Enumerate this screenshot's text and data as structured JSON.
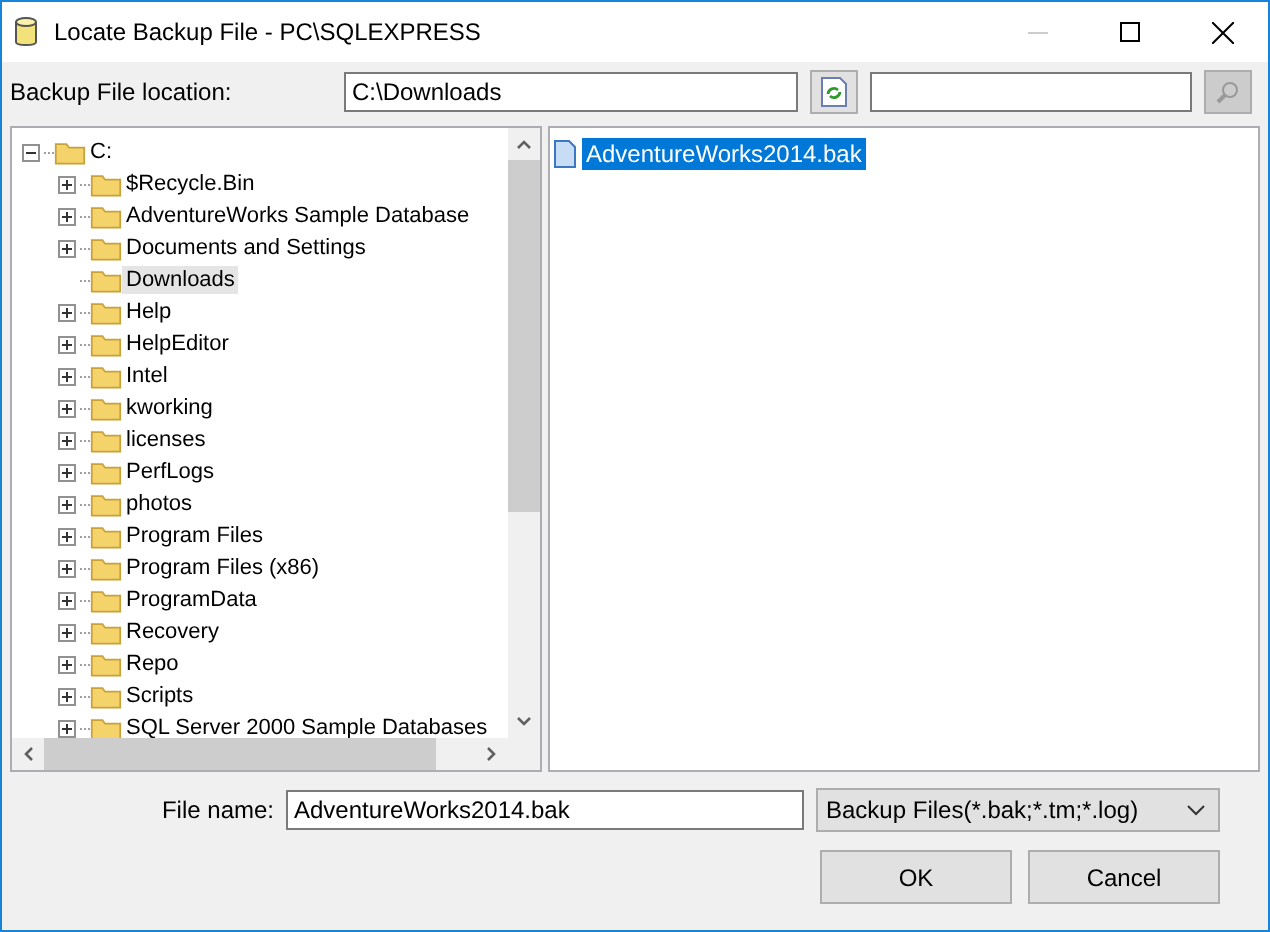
{
  "window": {
    "title": "Locate Backup File - PC\\SQLEXPRESS"
  },
  "location": {
    "label": "Backup File location:",
    "value": "C:\\Downloads"
  },
  "tree": [
    {
      "label": "C:",
      "expanded": true,
      "selected": false,
      "children": [
        {
          "label": "$Recycle.Bin",
          "expandable": true,
          "selected": false
        },
        {
          "label": "AdventureWorks Sample Database",
          "expandable": true,
          "selected": false
        },
        {
          "label": "Documents and Settings",
          "expandable": true,
          "selected": false
        },
        {
          "label": "Downloads",
          "expandable": false,
          "selected": true
        },
        {
          "label": "Help",
          "expandable": true,
          "selected": false
        },
        {
          "label": "HelpEditor",
          "expandable": true,
          "selected": false
        },
        {
          "label": "Intel",
          "expandable": true,
          "selected": false
        },
        {
          "label": "kworking",
          "expandable": true,
          "selected": false
        },
        {
          "label": "licenses",
          "expandable": true,
          "selected": false
        },
        {
          "label": "PerfLogs",
          "expandable": true,
          "selected": false
        },
        {
          "label": "photos",
          "expandable": true,
          "selected": false
        },
        {
          "label": "Program Files",
          "expandable": true,
          "selected": false
        },
        {
          "label": "Program Files (x86)",
          "expandable": true,
          "selected": false
        },
        {
          "label": "ProgramData",
          "expandable": true,
          "selected": false
        },
        {
          "label": "Recovery",
          "expandable": true,
          "selected": false
        },
        {
          "label": "Repo",
          "expandable": true,
          "selected": false
        },
        {
          "label": "Scripts",
          "expandable": true,
          "selected": false
        },
        {
          "label": "SQL Server 2000 Sample Databases",
          "expandable": true,
          "selected": false
        }
      ]
    }
  ],
  "files": [
    {
      "name": "AdventureWorks2014.bak",
      "selected": true
    }
  ],
  "file_name": {
    "label": "File name:",
    "value": "AdventureWorks2014.bak"
  },
  "file_type": {
    "value": "Backup Files(*.bak;*.tm;*.log)"
  },
  "buttons": [
    "OK",
    "Cancel"
  ]
}
